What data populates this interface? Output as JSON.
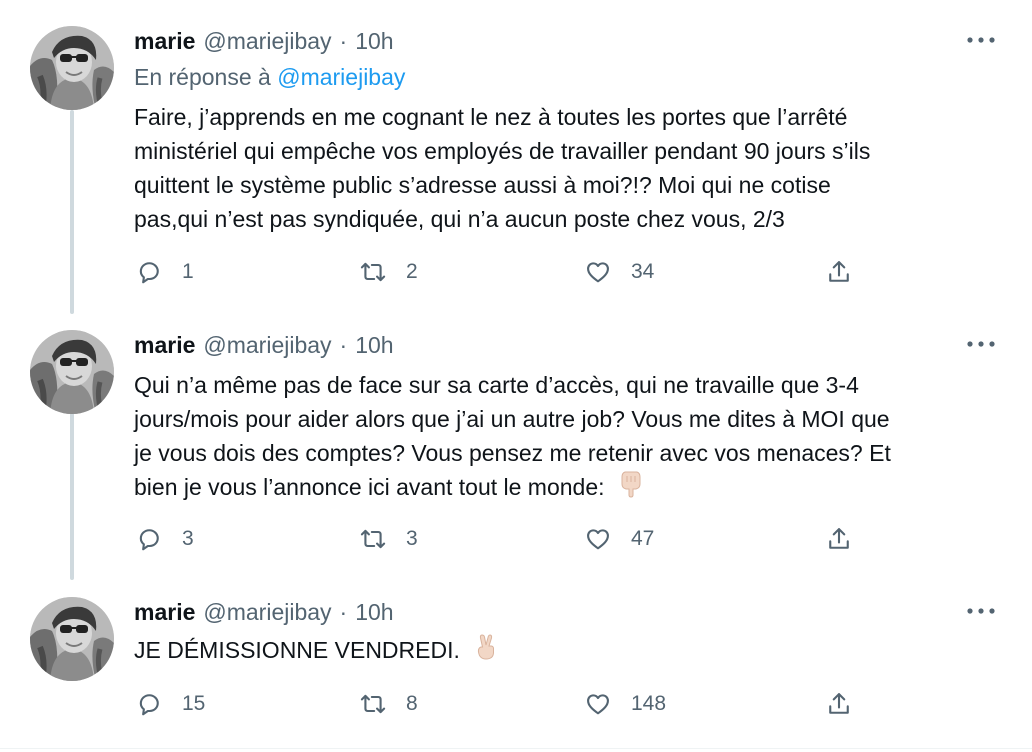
{
  "colors": {
    "text": "#0f1419",
    "secondary": "#536471",
    "link": "#1d9bf0",
    "thread_line": "#cfd9de"
  },
  "tweets": [
    {
      "author": {
        "name": "marie",
        "handle": "@mariejibay"
      },
      "separator": "·",
      "time": "10h",
      "reply_to": {
        "prefix": "En réponse à",
        "mention": "@mariejibay"
      },
      "text_lines": [
        "Faire, j’apprends en me cognant le nez à toutes les portes que l’arrêté",
        "ministériel qui empêche vos employés de travailler pendant 90 jours s’ils",
        "quittent le système public s’adresse aussi à moi?!? Moi qui ne cotise",
        "pas,qui n’est pas syndiquée, qui n’a aucun poste chez vous, 2/3"
      ],
      "stats": {
        "replies": "1",
        "retweets": "2",
        "likes": "34"
      }
    },
    {
      "author": {
        "name": "marie",
        "handle": "@mariejibay"
      },
      "separator": "·",
      "time": "10h",
      "text_lines": [
        "Qui n’a même pas de face sur sa carte d’accès, qui ne travaille que 3-4",
        "jours/mois pour aider alors que j’ai un autre job? Vous me dites à MOI que",
        "je vous dois des comptes? Vous pensez me retenir avec vos menaces? Et",
        "bien je vous l’annonce ici avant tout le monde:"
      ],
      "emoji": "pointing-down-emoji",
      "stats": {
        "replies": "3",
        "retweets": "3",
        "likes": "47"
      }
    },
    {
      "author": {
        "name": "marie",
        "handle": "@mariejibay"
      },
      "separator": "·",
      "time": "10h",
      "text_lines": [
        "JE DÉMISSIONNE VENDREDI."
      ],
      "emoji": "victory-hand-emoji",
      "stats": {
        "replies": "15",
        "retweets": "8",
        "likes": "148"
      }
    }
  ],
  "icons": {
    "more": "more-dots-icon",
    "reply": "reply-bubble-icon",
    "retweet": "retweet-icon",
    "like": "heart-icon",
    "share": "share-icon"
  }
}
